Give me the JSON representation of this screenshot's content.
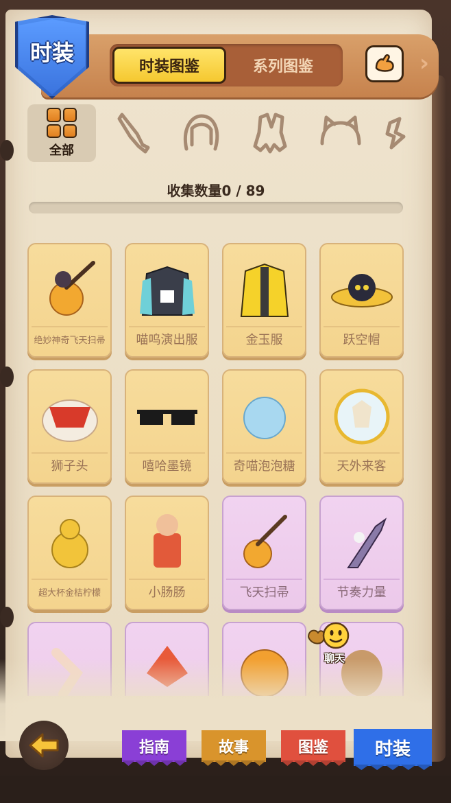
{
  "header": {
    "title": "时装",
    "tabs": [
      {
        "label": "时装图鉴",
        "active": true
      },
      {
        "label": "系列图鉴",
        "active": false
      }
    ],
    "arm_icon": "flex-arm-icon"
  },
  "categories": {
    "all_label": "全部",
    "icons": [
      "knife-icon",
      "hair-icon",
      "costume-icon",
      "cat-ears-icon",
      "accessory-icon"
    ]
  },
  "collection": {
    "label": "收集数量0 / 89",
    "collected": 0,
    "total": 89
  },
  "items": [
    {
      "name": "绝妙神奇飞天扫帚",
      "rarity": "gold"
    },
    {
      "name": "喵呜演出服",
      "rarity": "gold"
    },
    {
      "name": "金玉服",
      "rarity": "gold"
    },
    {
      "name": "跃空帽",
      "rarity": "gold"
    },
    {
      "name": "狮子头",
      "rarity": "gold"
    },
    {
      "name": "嘻哈墨镜",
      "rarity": "gold"
    },
    {
      "name": "奇喵泡泡糖",
      "rarity": "gold"
    },
    {
      "name": "天外来客",
      "rarity": "gold"
    },
    {
      "name": "超大杯金桔柠檬",
      "rarity": "gold"
    },
    {
      "name": "小肠肠",
      "rarity": "gold"
    },
    {
      "name": "飞天扫帚",
      "rarity": "purple"
    },
    {
      "name": "节奏力量",
      "rarity": "purple"
    },
    {
      "name": "",
      "rarity": "purple"
    },
    {
      "name": "",
      "rarity": "purple"
    },
    {
      "name": "",
      "rarity": "purple"
    },
    {
      "name": "",
      "rarity": "purple"
    }
  ],
  "chat": {
    "label": "聊天"
  },
  "bottom_nav": {
    "guide": "指南",
    "story": "故事",
    "atlas": "图鉴",
    "fashion": "时装"
  },
  "colors": {
    "gold_card": "#f4d48e",
    "purple_card": "#ecc9ea",
    "shield_blue": "#3b74de",
    "active_tab_yellow": "#f5c830"
  }
}
